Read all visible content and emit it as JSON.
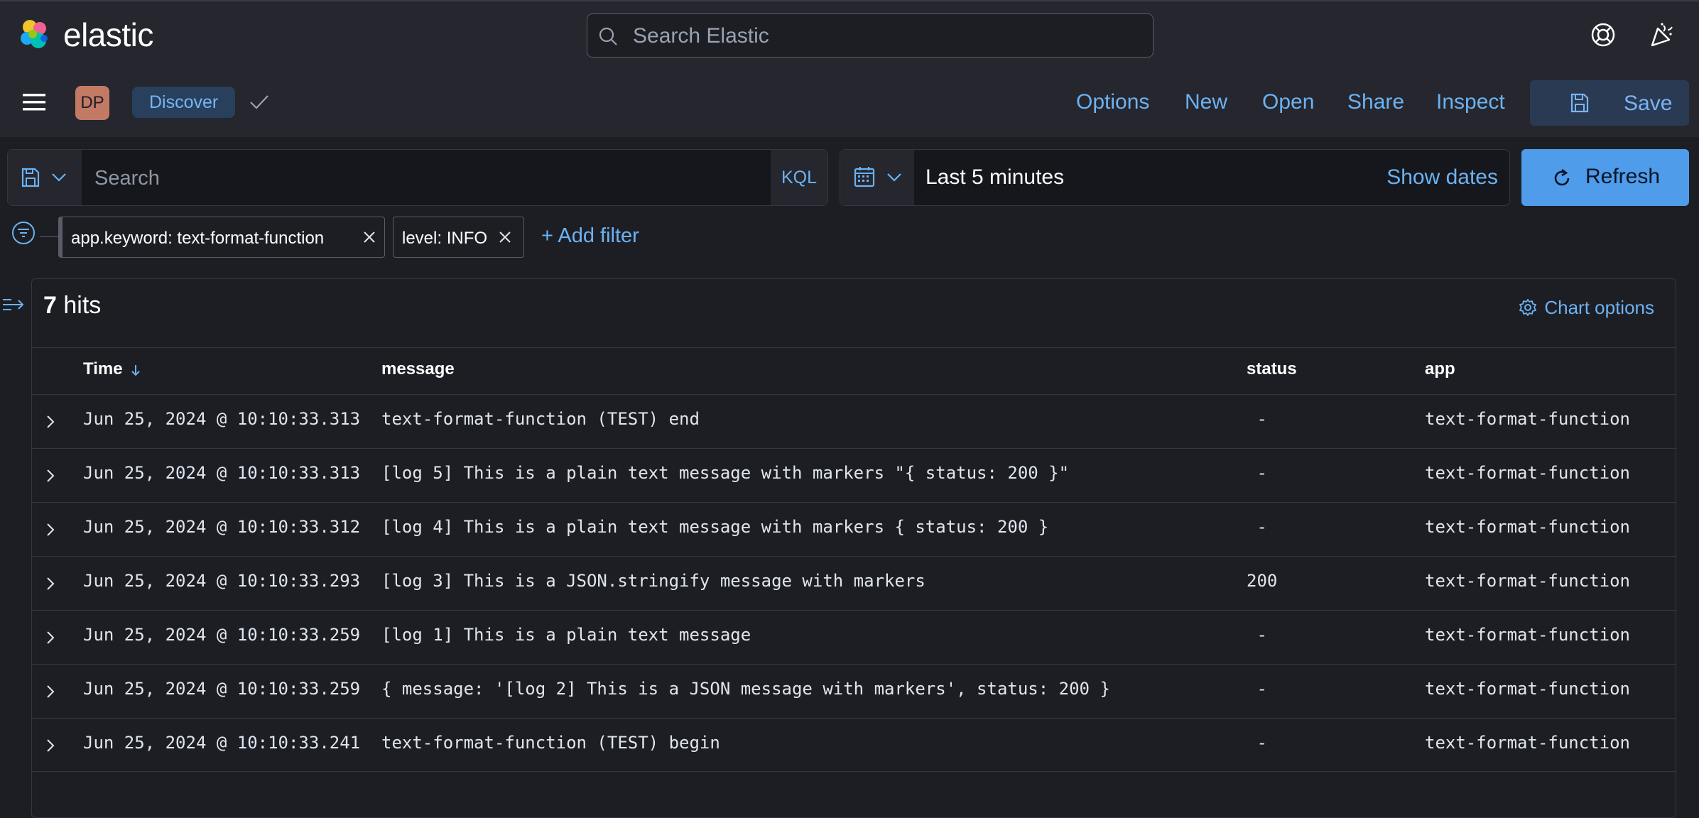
{
  "header": {
    "brand": "elastic",
    "search_placeholder": "Search Elastic"
  },
  "appbar": {
    "avatar_initials": "DP",
    "app_name": "Discover",
    "links": [
      "Options",
      "New",
      "Open",
      "Share",
      "Inspect"
    ],
    "save_label": "Save"
  },
  "query": {
    "placeholder": "Search",
    "language": "KQL",
    "date_range": "Last 5 minutes",
    "show_dates": "Show dates",
    "refresh_label": "Refresh"
  },
  "filters": {
    "pills": [
      "app.keyword: text-format-function",
      "level: INFO"
    ],
    "add_filter": "+ Add filter"
  },
  "results": {
    "hit_count": "7",
    "hits_label": "hits",
    "chart_options": "Chart options",
    "columns": [
      "Time",
      "message",
      "status",
      "app"
    ],
    "rows": [
      {
        "time": "Jun 25, 2024 @ 10:10:33.313",
        "message": "text-format-function (TEST) end",
        "status": " -",
        "app": "text-format-function"
      },
      {
        "time": "Jun 25, 2024 @ 10:10:33.313",
        "message": "[log 5] This is a plain text message with markers \"{ status: 200 }\"",
        "status": " -",
        "app": "text-format-function"
      },
      {
        "time": "Jun 25, 2024 @ 10:10:33.312",
        "message": "[log 4] This is a plain text message with markers { status: 200 }",
        "status": " -",
        "app": "text-format-function"
      },
      {
        "time": "Jun 25, 2024 @ 10:10:33.293",
        "message": "[log 3] This is a JSON.stringify message with markers",
        "status": "200",
        "app": "text-format-function"
      },
      {
        "time": "Jun 25, 2024 @ 10:10:33.259",
        "message": "[log 1] This is a plain text message",
        "status": " -",
        "app": "text-format-function"
      },
      {
        "time": "Jun 25, 2024 @ 10:10:33.259",
        "message": "{ message: '[log 2] This is a JSON message with markers', status: 200 }",
        "status": " -",
        "app": "text-format-function"
      },
      {
        "time": "Jun 25, 2024 @ 10:10:33.241",
        "message": "text-format-function (TEST) begin",
        "status": " -",
        "app": "text-format-function"
      }
    ]
  },
  "colors": {
    "accent": "#6cb2f2",
    "primary_button": "#4f9cea",
    "background": "#1d1e24",
    "header": "#25262e"
  },
  "icons": [
    "elastic-logo-icon",
    "search-icon",
    "help-icon",
    "news-icon",
    "menu-icon",
    "check-icon",
    "save-icon",
    "saved-query-icon",
    "chevron-down-icon",
    "calendar-icon",
    "refresh-icon",
    "filter-icon",
    "close-icon",
    "sidebar-toggle-icon",
    "gear-icon",
    "sort-down-icon",
    "expand-row-icon"
  ]
}
